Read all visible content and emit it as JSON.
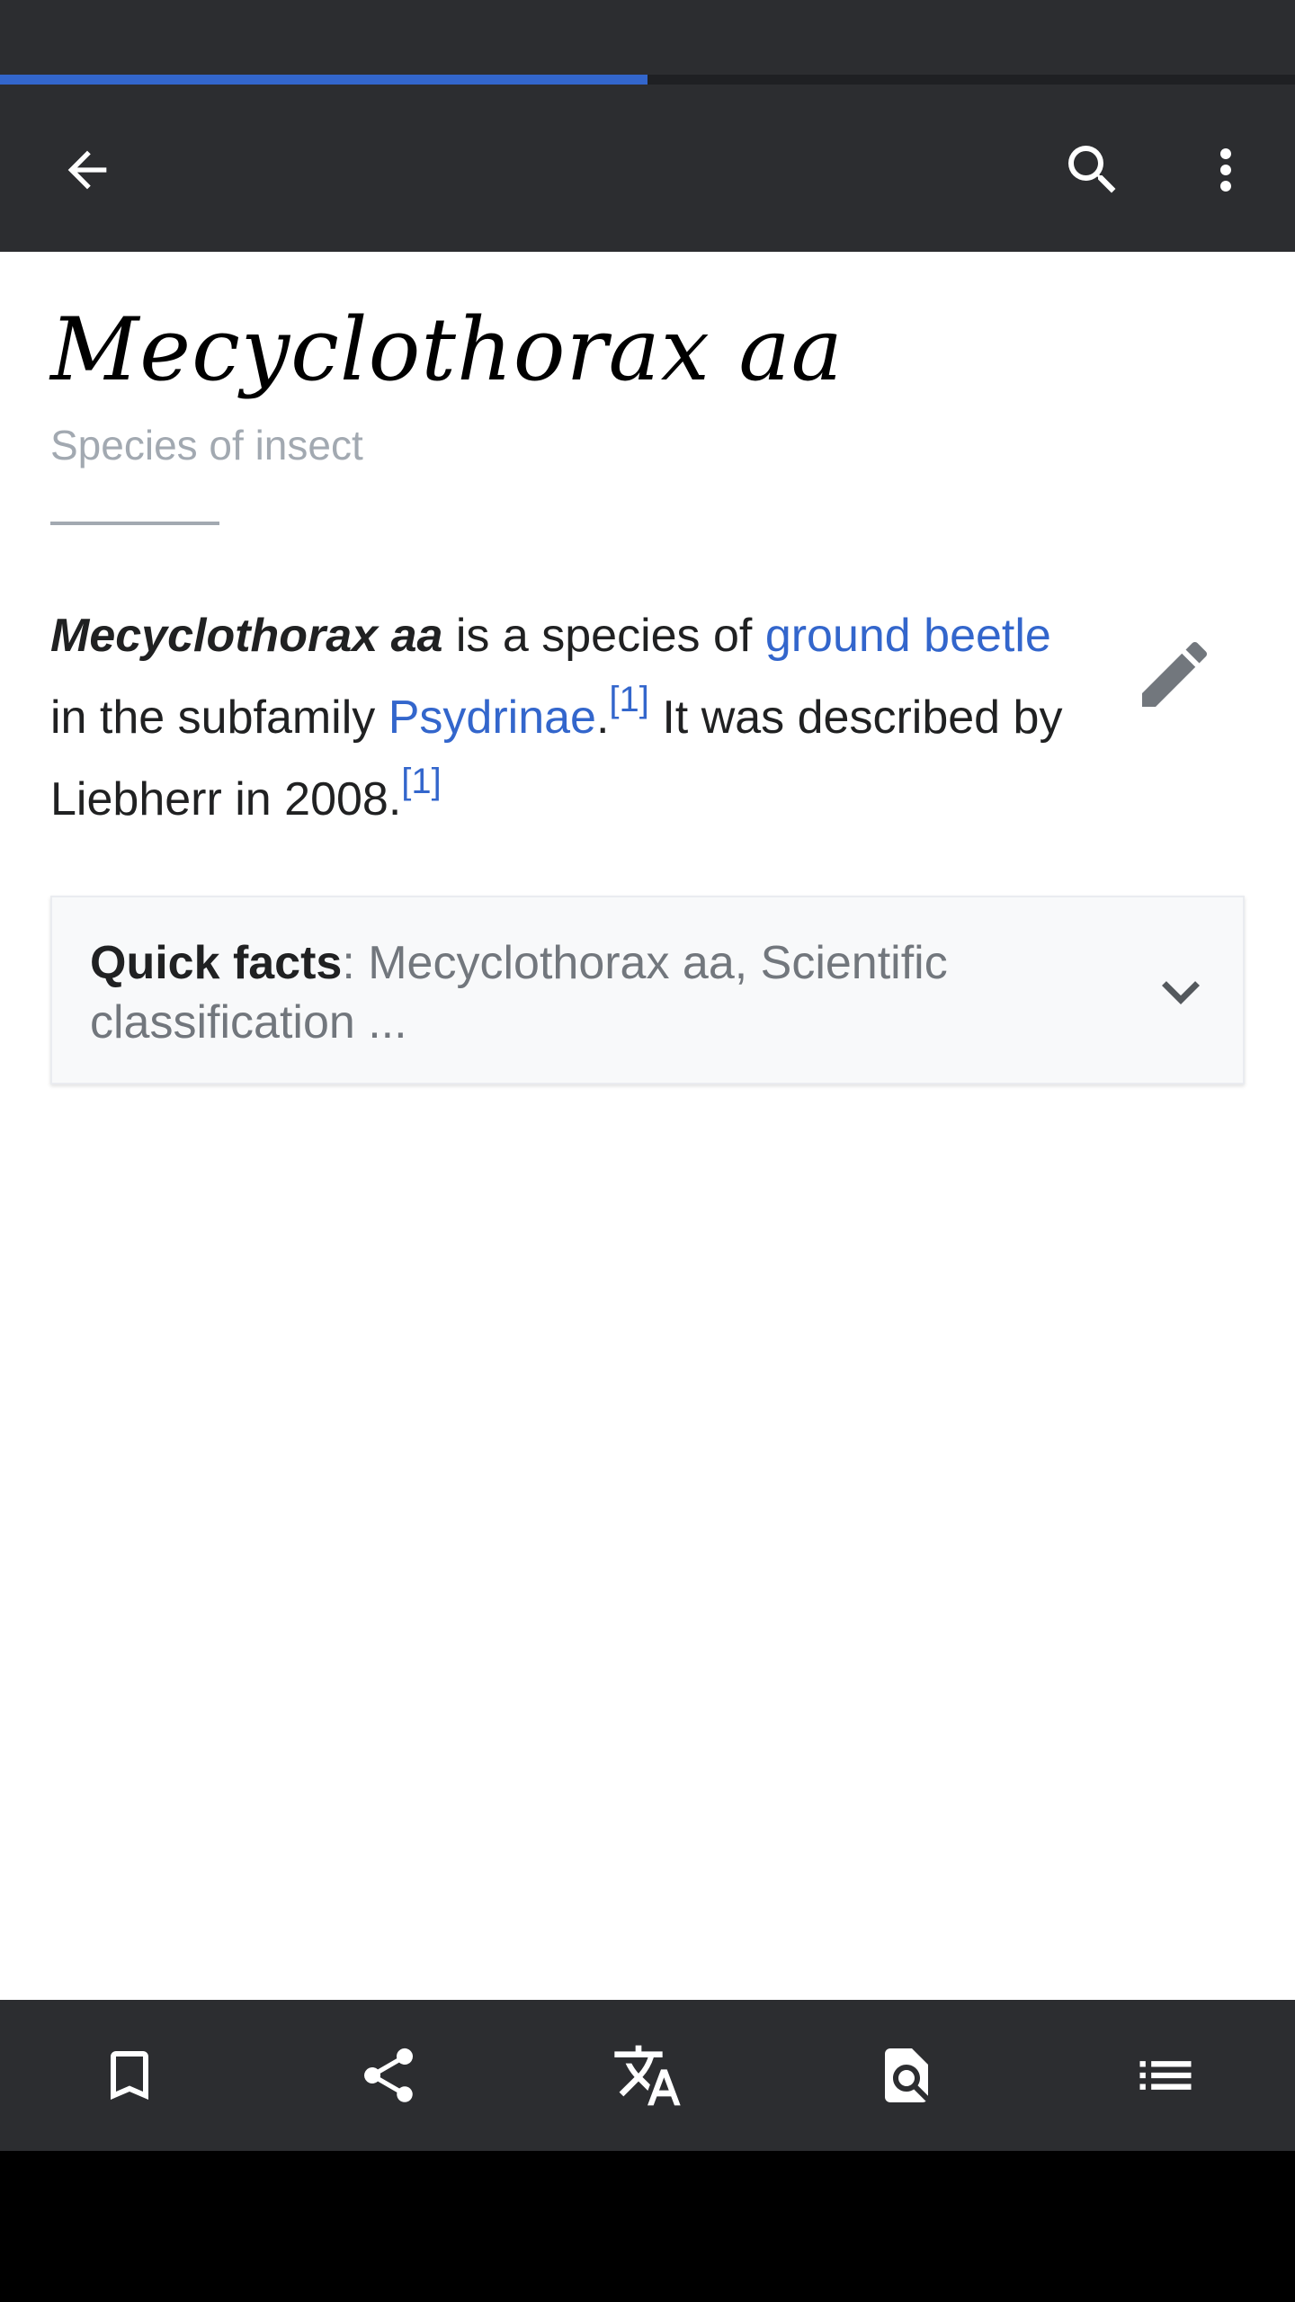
{
  "loading_progress": 0.5,
  "toolbar": {
    "back_icon": "arrow-left-icon",
    "search_icon": "search-icon",
    "more_icon": "more-vertical-icon"
  },
  "article": {
    "title": "Mecyclothorax aa",
    "description": "Species of insect",
    "lead": {
      "subject": "Mecyclothorax aa",
      "text_1": " is a species of ",
      "link_1": "ground beetle",
      "text_2": " in the subfamily ",
      "link_2": "Psydrinae",
      "text_3": ".",
      "ref_1": "[1]",
      "text_4": " It was described by Liebherr in 2008.",
      "ref_2": "[1]"
    },
    "edit_icon": "pencil-icon"
  },
  "quick_facts": {
    "label": "Quick facts",
    "summary": ": Mecyclothorax aa, Scientific classification ...",
    "chevron_icon": "chevron-down-icon"
  },
  "bottom_bar": {
    "bookmark_icon": "bookmark-icon",
    "share_icon": "share-icon",
    "language_icon": "translate-icon",
    "find_icon": "find-in-page-icon",
    "contents_icon": "table-of-contents-icon"
  },
  "colors": {
    "toolbar_bg": "#2c2d30",
    "progress": "#3366cc",
    "link": "#3366cc",
    "text": "#202122",
    "muted": "#a2a9b1"
  }
}
